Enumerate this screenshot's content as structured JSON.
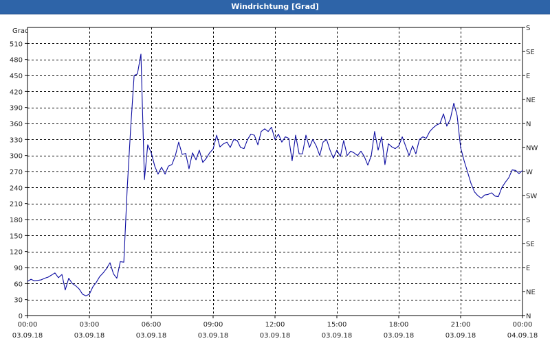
{
  "window": {
    "title": "Windrichtung [Grad]"
  },
  "chart_data": {
    "type": "line",
    "title": "Windrichtung [Grad]",
    "ylabel": "Grad",
    "xlabel": "",
    "ylim": [
      0,
      540
    ],
    "xlim_hours": [
      0,
      24
    ],
    "yticks": [
      0,
      30,
      60,
      90,
      120,
      150,
      180,
      210,
      240,
      270,
      300,
      330,
      360,
      390,
      420,
      450,
      480,
      510
    ],
    "right_ticks": [
      {
        "value": 0,
        "label": "N"
      },
      {
        "value": 45,
        "label": "NE"
      },
      {
        "value": 90,
        "label": "E"
      },
      {
        "value": 135,
        "label": "SE"
      },
      {
        "value": 180,
        "label": "S"
      },
      {
        "value": 225,
        "label": "SW"
      },
      {
        "value": 270,
        "label": "W"
      },
      {
        "value": 315,
        "label": "NW"
      },
      {
        "value": 360,
        "label": "N"
      },
      {
        "value": 405,
        "label": "NE"
      },
      {
        "value": 450,
        "label": "E"
      },
      {
        "value": 495,
        "label": "SE"
      },
      {
        "value": 540,
        "label": "S"
      }
    ],
    "xticks": [
      {
        "hour": 0,
        "time": "00:00",
        "date": "03.09.18"
      },
      {
        "hour": 3,
        "time": "03:00",
        "date": "03.09.18"
      },
      {
        "hour": 6,
        "time": "06:00",
        "date": "03.09.18"
      },
      {
        "hour": 9,
        "time": "09:00",
        "date": "03.09.18"
      },
      {
        "hour": 12,
        "time": "12:00",
        "date": "03.09.18"
      },
      {
        "hour": 15,
        "time": "15:00",
        "date": "03.09.18"
      },
      {
        "hour": 18,
        "time": "18:00",
        "date": "03.09.18"
      },
      {
        "hour": 21,
        "time": "21:00",
        "date": "03.09.18"
      },
      {
        "hour": 24,
        "time": "00:00",
        "date": "04.09.18"
      }
    ],
    "grid": true,
    "series": [
      {
        "color": "#0a0aa0",
        "points": [
          [
            0.0,
            64
          ],
          [
            0.17,
            68
          ],
          [
            0.33,
            65
          ],
          [
            0.5,
            66
          ],
          [
            0.67,
            67
          ],
          [
            0.83,
            70
          ],
          [
            1.0,
            72
          ],
          [
            1.17,
            76
          ],
          [
            1.33,
            80
          ],
          [
            1.5,
            71
          ],
          [
            1.67,
            77
          ],
          [
            1.83,
            48
          ],
          [
            2.0,
            70
          ],
          [
            2.17,
            60
          ],
          [
            2.33,
            56
          ],
          [
            2.5,
            50
          ],
          [
            2.67,
            40
          ],
          [
            2.83,
            37
          ],
          [
            3.0,
            40
          ],
          [
            3.17,
            54
          ],
          [
            3.33,
            62
          ],
          [
            3.5,
            73
          ],
          [
            3.67,
            80
          ],
          [
            3.83,
            88
          ],
          [
            4.0,
            99
          ],
          [
            4.17,
            78
          ],
          [
            4.33,
            70
          ],
          [
            4.5,
            101
          ],
          [
            4.67,
            100
          ],
          [
            4.83,
            235
          ],
          [
            5.0,
            350
          ],
          [
            5.17,
            450
          ],
          [
            5.33,
            453
          ],
          [
            5.5,
            490
          ],
          [
            5.67,
            255
          ],
          [
            5.83,
            320
          ],
          [
            6.0,
            305
          ],
          [
            6.17,
            280
          ],
          [
            6.33,
            265
          ],
          [
            6.5,
            278
          ],
          [
            6.67,
            265
          ],
          [
            6.83,
            280
          ],
          [
            7.0,
            283
          ],
          [
            7.17,
            300
          ],
          [
            7.33,
            325
          ],
          [
            7.5,
            302
          ],
          [
            7.67,
            304
          ],
          [
            7.83,
            275
          ],
          [
            8.0,
            305
          ],
          [
            8.17,
            292
          ],
          [
            8.33,
            310
          ],
          [
            8.5,
            287
          ],
          [
            8.67,
            295
          ],
          [
            8.83,
            305
          ],
          [
            9.0,
            312
          ],
          [
            9.17,
            338
          ],
          [
            9.33,
            316
          ],
          [
            9.5,
            322
          ],
          [
            9.67,
            325
          ],
          [
            9.83,
            315
          ],
          [
            10.0,
            330
          ],
          [
            10.17,
            328
          ],
          [
            10.33,
            315
          ],
          [
            10.5,
            313
          ],
          [
            10.67,
            330
          ],
          [
            10.83,
            340
          ],
          [
            11.0,
            338
          ],
          [
            11.17,
            320
          ],
          [
            11.33,
            345
          ],
          [
            11.5,
            350
          ],
          [
            11.67,
            345
          ],
          [
            11.83,
            353
          ],
          [
            12.0,
            330
          ],
          [
            12.17,
            340
          ],
          [
            12.33,
            325
          ],
          [
            12.5,
            335
          ],
          [
            12.67,
            332
          ],
          [
            12.83,
            290
          ],
          [
            13.0,
            338
          ],
          [
            13.17,
            303
          ],
          [
            13.33,
            303
          ],
          [
            13.5,
            338
          ],
          [
            13.67,
            315
          ],
          [
            13.83,
            330
          ],
          [
            14.0,
            318
          ],
          [
            14.17,
            300
          ],
          [
            14.33,
            325
          ],
          [
            14.5,
            330
          ],
          [
            14.67,
            310
          ],
          [
            14.83,
            295
          ],
          [
            15.0,
            310
          ],
          [
            15.17,
            298
          ],
          [
            15.33,
            328
          ],
          [
            15.5,
            300
          ],
          [
            15.67,
            308
          ],
          [
            15.83,
            305
          ],
          [
            16.0,
            300
          ],
          [
            16.17,
            308
          ],
          [
            16.33,
            298
          ],
          [
            16.5,
            282
          ],
          [
            16.67,
            300
          ],
          [
            16.83,
            345
          ],
          [
            17.0,
            310
          ],
          [
            17.17,
            335
          ],
          [
            17.33,
            283
          ],
          [
            17.5,
            322
          ],
          [
            17.67,
            316
          ],
          [
            17.83,
            313
          ],
          [
            18.0,
            318
          ],
          [
            18.17,
            335
          ],
          [
            18.33,
            318
          ],
          [
            18.5,
            300
          ],
          [
            18.67,
            318
          ],
          [
            18.83,
            303
          ],
          [
            19.0,
            330
          ],
          [
            19.17,
            335
          ],
          [
            19.33,
            332
          ],
          [
            19.5,
            345
          ],
          [
            19.67,
            352
          ],
          [
            19.83,
            357
          ],
          [
            20.0,
            360
          ],
          [
            20.17,
            378
          ],
          [
            20.33,
            355
          ],
          [
            20.5,
            368
          ],
          [
            20.67,
            398
          ],
          [
            20.83,
            375
          ],
          [
            21.0,
            315
          ],
          [
            21.17,
            290
          ],
          [
            21.33,
            270
          ],
          [
            21.5,
            248
          ],
          [
            21.67,
            232
          ],
          [
            21.83,
            225
          ],
          [
            22.0,
            220
          ],
          [
            22.17,
            226
          ],
          [
            22.33,
            227
          ],
          [
            22.5,
            230
          ],
          [
            22.67,
            224
          ],
          [
            22.83,
            223
          ],
          [
            23.0,
            240
          ],
          [
            23.17,
            250
          ],
          [
            23.33,
            258
          ],
          [
            23.5,
            273
          ],
          [
            23.67,
            272
          ],
          [
            23.83,
            266
          ],
          [
            24.0,
            272
          ]
        ]
      }
    ]
  }
}
